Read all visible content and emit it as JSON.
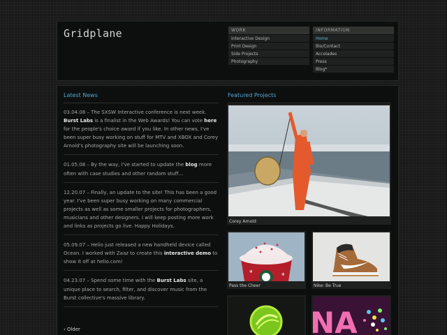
{
  "site": {
    "logo": "Gridplane"
  },
  "nav": {
    "work_heading": "WORK",
    "work_items": [
      "Interactive Design",
      "Print Design",
      "Side Projects",
      "Photography"
    ],
    "info_heading": "INFORMATION",
    "info_items": [
      "Home",
      "Bio/Contact",
      "Accolades",
      "Press",
      "Blog*"
    ],
    "active_item": "Home",
    "accent_color": "#5fb3d8"
  },
  "news": {
    "title": "Latest News",
    "items": [
      {
        "date": "03.04.08",
        "sep": " – ",
        "t1": "The SXSW Interactive conference is next week. ",
        "l1": "Burst Labs",
        "t2": " is a finalist in the Web Awards! You can vote ",
        "l2": "here",
        "t3": " for the people's choice award if you like. In other news, I've been super busy working on stuff for MTV and XBOX and Corey Arnold's photography site will be launching soon."
      },
      {
        "date": "01.05.08",
        "sep": " – ",
        "t1": "By the way, I've started to update the ",
        "l1": "blog",
        "t2": " more often with case studies and other random stuff…",
        "l2": "",
        "t3": ""
      },
      {
        "date": "12.20.07",
        "sep": " – ",
        "t1": "Finally, an update to the site! This has been a good year. I've been super busy working on many commercial projects as well as some smaller projects for photographers, musicians and other designers. I will keep posting more work and links as projects go live. Happy Holidays.",
        "l1": "",
        "t2": "",
        "l2": "",
        "t3": ""
      },
      {
        "date": "05.09.07",
        "sep": " – ",
        "t1": "Helio just released a new handheld device called Ocean. I worked with Zaaz to create this ",
        "l1": "interactive demo",
        "t2": " to show it off at helio.com!",
        "l2": "",
        "t3": ""
      },
      {
        "date": "04.23.07",
        "sep": " – ",
        "t1": "Spend some time with the ",
        "l1": "Burst Labs",
        "t2": " site, a unique place to search, filter, and discover music from the Burst collective's massive library.",
        "l2": "",
        "t3": ""
      }
    ],
    "older_label": "Older"
  },
  "featured": {
    "title": "Featured Projects",
    "projects": [
      {
        "caption": "Corey Arnold"
      },
      {
        "caption": "Pass the Cheer"
      },
      {
        "caption": "Nike: Be True"
      },
      {
        "caption": ""
      },
      {
        "caption": ""
      }
    ]
  }
}
